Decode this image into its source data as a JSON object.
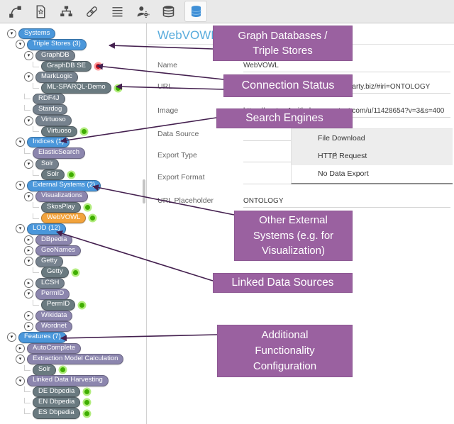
{
  "colors": {
    "blue": "#4A97DB",
    "gray": "#76828E",
    "lavender": "#8C86AE",
    "dark": "#6A7A80",
    "orange": "#F2A33C",
    "status_green": "#3FAE00",
    "status_red": "#C40F1E",
    "callout_bg": "#9A61A0",
    "arrow": "#44204F",
    "accent_blue": "#57ABDC"
  },
  "toolbar": {
    "icons": [
      {
        "name": "connections-icon",
        "active": false
      },
      {
        "name": "document-star-icon",
        "active": false
      },
      {
        "name": "hierarchy-icon",
        "active": false
      },
      {
        "name": "link-icon",
        "active": false
      },
      {
        "name": "list-icon",
        "active": false
      },
      {
        "name": "user-settings-icon",
        "active": false
      },
      {
        "name": "databases-icon",
        "active": false
      },
      {
        "name": "database-active-icon",
        "active": true
      }
    ]
  },
  "tree": {
    "items": [
      {
        "label": "Systems",
        "variant": "blue",
        "indent": 0,
        "expander": "expanded",
        "status": null
      },
      {
        "label": "Triple Stores (3)",
        "variant": "blue",
        "indent": 1,
        "expander": "expanded",
        "status": null
      },
      {
        "label": "GraphDB",
        "variant": "gray",
        "indent": 2,
        "expander": "expanded",
        "status": null
      },
      {
        "label": "GraphDB SE",
        "variant": "dark",
        "indent": 3,
        "expander": "none",
        "status": "red"
      },
      {
        "label": "MarkLogic",
        "variant": "gray",
        "indent": 2,
        "expander": "expanded",
        "status": null
      },
      {
        "label": "ML-SPARQL-Demo",
        "variant": "dark",
        "indent": 3,
        "expander": "none",
        "status": "green"
      },
      {
        "label": "RDF4J",
        "variant": "gray",
        "indent": 2,
        "expander": "none",
        "status": null
      },
      {
        "label": "Stardog",
        "variant": "gray",
        "indent": 2,
        "expander": "none",
        "status": null
      },
      {
        "label": "Virtuoso",
        "variant": "gray",
        "indent": 2,
        "expander": "expanded",
        "status": null
      },
      {
        "label": "Virtuoso",
        "variant": "dark",
        "indent": 3,
        "expander": "none",
        "status": "green"
      },
      {
        "label": "Indices (1)",
        "variant": "blue",
        "indent": 1,
        "expander": "expanded",
        "status": null
      },
      {
        "label": "ElasticSearch",
        "variant": "lavender",
        "indent": 2,
        "expander": "none",
        "status": null
      },
      {
        "label": "Solr",
        "variant": "gray",
        "indent": 2,
        "expander": "expanded",
        "status": null
      },
      {
        "label": "Solr",
        "variant": "dark",
        "indent": 3,
        "expander": "none",
        "status": "green"
      },
      {
        "label": "External Systems (2)",
        "variant": "blue",
        "indent": 1,
        "expander": "expanded",
        "status": null
      },
      {
        "label": "Visualizations",
        "variant": "lavender",
        "indent": 2,
        "expander": "expanded",
        "status": null
      },
      {
        "label": "SkosPlay",
        "variant": "dark",
        "indent": 3,
        "expander": "none",
        "status": "green"
      },
      {
        "label": "WebVOWL",
        "variant": "orange",
        "indent": 3,
        "expander": "none",
        "status": "green",
        "selected": true
      },
      {
        "label": "LOD (12)",
        "variant": "blue",
        "indent": 1,
        "expander": "expanded",
        "status": null
      },
      {
        "label": "DBpedia",
        "variant": "lavender",
        "indent": 2,
        "expander": "collapsed",
        "status": null
      },
      {
        "label": "GeoNames",
        "variant": "lavender",
        "indent": 2,
        "expander": "collapsed",
        "status": null
      },
      {
        "label": "Getty",
        "variant": "gray",
        "indent": 2,
        "expander": "expanded",
        "status": null
      },
      {
        "label": "Getty",
        "variant": "dark",
        "indent": 3,
        "expander": "none",
        "status": "green"
      },
      {
        "label": "LCSH",
        "variant": "gray",
        "indent": 2,
        "expander": "collapsed",
        "status": null
      },
      {
        "label": "PermID",
        "variant": "lavender",
        "indent": 2,
        "expander": "expanded",
        "status": null
      },
      {
        "label": "PermID",
        "variant": "dark",
        "indent": 3,
        "expander": "none",
        "status": "green"
      },
      {
        "label": "Wikidata",
        "variant": "lavender",
        "indent": 2,
        "expander": "collapsed",
        "status": null
      },
      {
        "label": "Wordnet",
        "variant": "lavender",
        "indent": 2,
        "expander": "collapsed",
        "status": null
      },
      {
        "label": "Features (7)",
        "variant": "blue",
        "indent": 0,
        "expander": "expanded",
        "status": null
      },
      {
        "label": "AutoComplete",
        "variant": "lavender",
        "indent": 1,
        "expander": "collapsed",
        "status": null
      },
      {
        "label": "Extraction Model Calculation",
        "variant": "lavender",
        "indent": 1,
        "expander": "expanded",
        "status": null
      },
      {
        "label": "Solr",
        "variant": "dark",
        "indent": 2,
        "expander": "none",
        "status": "green"
      },
      {
        "label": "Linked Data Harvesting",
        "variant": "lavender",
        "indent": 1,
        "expander": "expanded",
        "status": null
      },
      {
        "label": "DE Dbpedia",
        "variant": "dark",
        "indent": 2,
        "expander": "none",
        "status": "green"
      },
      {
        "label": "EN Dbpedia",
        "variant": "dark",
        "indent": 2,
        "expander": "none",
        "status": "green"
      },
      {
        "label": "ES Dbpedia",
        "variant": "dark",
        "indent": 2,
        "expander": "none",
        "status": "green"
      }
    ]
  },
  "form": {
    "title": "WebVOWL",
    "fields": [
      {
        "label": "Name",
        "value": "WebVOWL"
      },
      {
        "label": "URL",
        "value": "https://visualization-webvowl.poolparty.biz/#iri=ONTOLOGY"
      },
      {
        "label": "Image",
        "value": "https://avatars1.githubusercontent.com/u/11428654?v=3&s=400"
      },
      {
        "label": "Data Source",
        "value": ""
      },
      {
        "label": "Export Type",
        "value": ""
      },
      {
        "label": "Export Format",
        "value": ""
      },
      {
        "label": "URL Placeholder",
        "value": "ONTOLOGY"
      }
    ],
    "dropdown": {
      "options": [
        "File Download",
        "HTTP Request",
        "No Data Export"
      ],
      "hovered": "HTTP Request"
    },
    "cursor_glyph": "☝"
  },
  "callouts": [
    {
      "id": "graph-databases",
      "text": "Graph Databases /\nTriple Stores"
    },
    {
      "id": "connection-status",
      "text": "Connection Status"
    },
    {
      "id": "search-engines",
      "text": "Search Engines"
    },
    {
      "id": "other-external-systems",
      "text": "Other External\nSystems (e.g. for\nVisualization)"
    },
    {
      "id": "linked-data-sources",
      "text": "Linked Data Sources"
    },
    {
      "id": "additional-functionality",
      "text": "Additional\nFunctionality\nConfiguration"
    }
  ]
}
